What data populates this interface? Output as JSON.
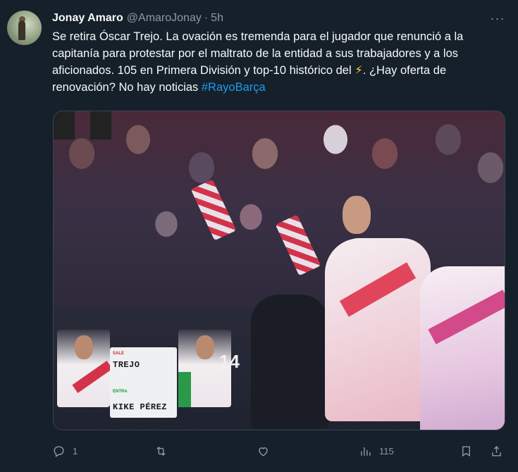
{
  "tweet": {
    "author_name": "Jonay Amaro",
    "author_handle": "@AmaroJonay",
    "separator": "·",
    "time": "5h",
    "text_before_bolt": "Se retira Óscar Trejo. La ovación es tremenda para el jugador que renunció a la capitanía para protestar por el maltrato de la entidad a sus trabajadores y a los aficionados. 105 en Primera División y top-10 histórico del ",
    "bolt_emoji": "⚡",
    "text_after_bolt": ". ¿Hay oferta de renovación? No hay noticias ",
    "hashtag": "#RayoBarça"
  },
  "media": {
    "board_out_label": "SALE",
    "board_out_name": "TREJO",
    "board_in_label": "ENTRA",
    "board_in_name": "KIKE PÉREZ",
    "jersey_number": "14"
  },
  "actions": {
    "reply_count": "1",
    "retweet_count": "",
    "like_count": "",
    "views_count": "115"
  },
  "icons": {
    "more": "more-horizontal-icon",
    "reply": "reply-icon",
    "retweet": "retweet-icon",
    "like": "heart-icon",
    "views": "views-icon",
    "bookmark": "bookmark-icon",
    "share": "share-icon"
  },
  "colors": {
    "background": "#15202b",
    "text": "#f7f9f9",
    "muted": "#8b98a5",
    "link": "#1d9bf0"
  }
}
